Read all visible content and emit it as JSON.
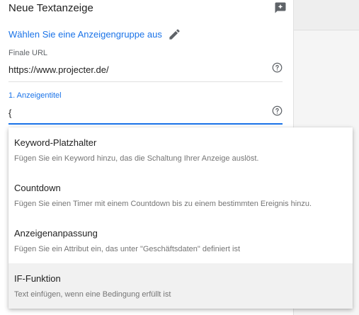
{
  "header": {
    "title": "Neue Textanzeige"
  },
  "adgroup": {
    "link_label": "Wählen Sie eine Anzeigengruppe aus"
  },
  "final_url": {
    "label": "Finale URL",
    "value": "https://www.projecter.de/"
  },
  "headline1": {
    "label": "1. Anzeigentitel",
    "value": "{"
  },
  "dropdown": {
    "items": [
      {
        "name": "Keyword-Platzhalter",
        "description": "Fügen Sie ein Keyword hinzu, das die Schaltung Ihrer Anzeige auslöst."
      },
      {
        "name": "Countdown",
        "description": "Fügen Sie einen Timer mit einem Countdown bis zu einem bestimmten Ereignis hinzu."
      },
      {
        "name": "Anzeigenanpassung",
        "description": "Fügen Sie ein Attribut ein, das unter \"Geschäftsdaten\" definiert ist"
      },
      {
        "name": "IF-Funktion",
        "description": "Text einfügen, wenn eine Bedingung erfüllt ist"
      }
    ]
  },
  "colors": {
    "accent": "#1a73e8",
    "text": "#212121",
    "secondary_text": "#757575",
    "highlight_row": "#f1f1f1"
  }
}
